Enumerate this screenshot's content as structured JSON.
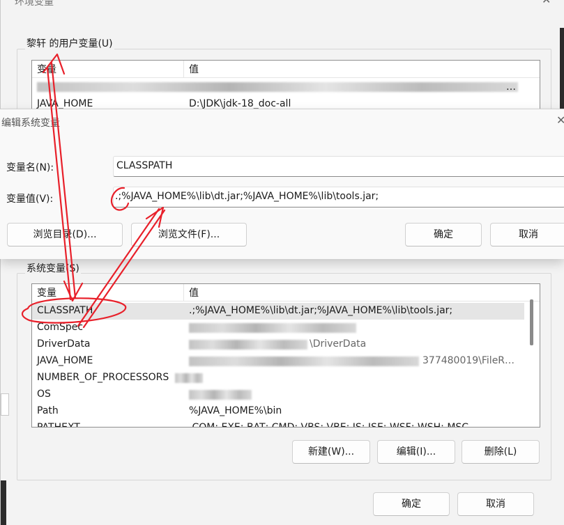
{
  "env_window": {
    "title": "环境变量",
    "close_icon": "✕",
    "user_group_label": "黎轩 的用户变量(U)",
    "user_table": {
      "col_name": "变量",
      "col_value": "值",
      "rows": [
        {
          "name": "",
          "value": "…",
          "blurred": true
        },
        {
          "name": "JAVA_HOME",
          "value": "D:\\JDK\\jdk-18_doc-all"
        }
      ]
    },
    "system_group_label": "系统变量(S)",
    "system_table": {
      "col_name": "变量",
      "col_value": "值",
      "rows": [
        {
          "name": "CLASSPATH",
          "value": ".;%JAVA_HOME%\\lib\\dt.jar;%JAVA_HOME%\\lib\\tools.jar;",
          "selected": true
        },
        {
          "name": "ComSpec",
          "value": "",
          "blurred": true
        },
        {
          "name": "DriverData",
          "value": "\\DriverData",
          "blurred": true
        },
        {
          "name": "JAVA_HOME",
          "value": "377480019\\FileR…",
          "blurred": true
        },
        {
          "name": "NUMBER_OF_PROCESSORS",
          "value": "",
          "blurred": true
        },
        {
          "name": "OS",
          "value": "",
          "blurred": true
        },
        {
          "name": "Path",
          "value": "%JAVA_HOME%\\bin"
        },
        {
          "name": "PATHEXT",
          "value": ".COM;.EXE;.BAT;.CMD;.VBS;.VBE;.JS;.JSE;.WSF;.WSH;.MSC"
        }
      ]
    },
    "buttons": {
      "new": "新建(W)...",
      "edit": "编辑(I)...",
      "delete": "删除(L)"
    },
    "footer": {
      "ok": "确定",
      "cancel": "取消"
    }
  },
  "edit_dialog": {
    "title": "编辑系统变量",
    "close_icon": "✕",
    "name_label": "变量名(N):",
    "name_value": "CLASSPATH",
    "value_label": "变量值(V):",
    "value_value": ".;%JAVA_HOME%\\lib\\dt.jar;%JAVA_HOME%\\lib\\tools.jar;",
    "buttons": {
      "browse_dir": "浏览目录(D)...",
      "browse_file": "浏览文件(F)...",
      "ok": "确定",
      "cancel": "取消"
    }
  },
  "annotations": {
    "color": "#e8202a"
  }
}
